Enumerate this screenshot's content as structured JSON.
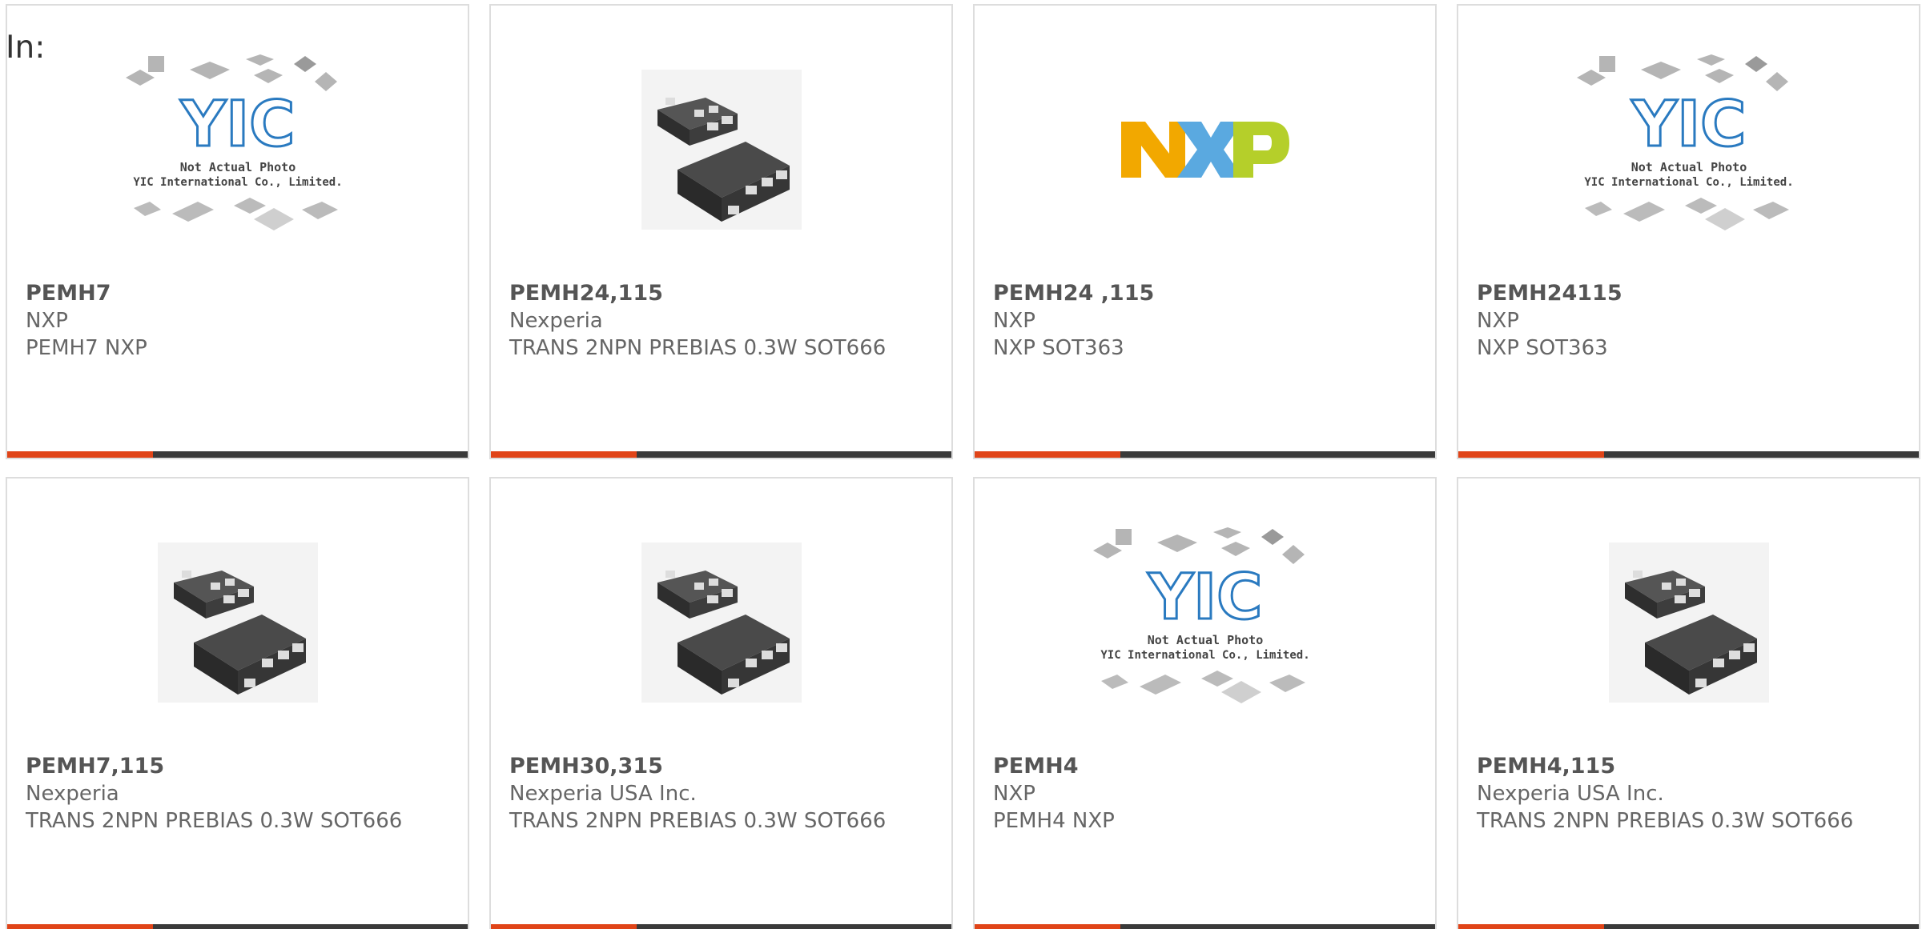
{
  "header": {
    "label": "In:"
  },
  "placeholder": {
    "logo_text": "YIC",
    "line1": "Not Actual Photo",
    "line2": "YIC International Co., Limited."
  },
  "brand_logo": {
    "text": "NXP"
  },
  "colors": {
    "accent": "#e04418",
    "bar": "#3a3a3a",
    "border": "#dddddd",
    "text": "#666666",
    "nxp_yellow": "#f2a800",
    "nxp_blue": "#5aa9e0",
    "nxp_green": "#b5cf2a",
    "yic_blue": "#2a7ac0"
  },
  "cards": [
    {
      "image": "placeholder",
      "part": "PEMH7",
      "maker": "NXP",
      "desc": "PEMH7 NXP"
    },
    {
      "image": "chip",
      "part": "PEMH24,115",
      "maker": "Nexperia",
      "desc": "TRANS 2NPN PREBIAS 0.3W SOT666"
    },
    {
      "image": "nxp-logo",
      "part": "PEMH24 ,115",
      "maker": "NXP",
      "desc": "NXP SOT363"
    },
    {
      "image": "placeholder",
      "part": "PEMH24115",
      "maker": "NXP",
      "desc": "NXP SOT363"
    },
    {
      "image": "chip",
      "part": "PEMH7,115",
      "maker": "Nexperia",
      "desc": "TRANS 2NPN PREBIAS 0.3W SOT666"
    },
    {
      "image": "chip",
      "part": "PEMH30,315",
      "maker": "Nexperia USA Inc.",
      "desc": "TRANS 2NPN PREBIAS 0.3W SOT666"
    },
    {
      "image": "placeholder",
      "part": "PEMH4",
      "maker": "NXP",
      "desc": "PEMH4 NXP"
    },
    {
      "image": "chip",
      "part": "PEMH4,115",
      "maker": "Nexperia USA Inc.",
      "desc": "TRANS 2NPN PREBIAS 0.3W SOT666"
    }
  ]
}
